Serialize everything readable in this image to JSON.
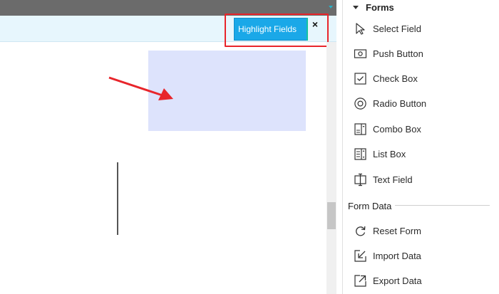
{
  "toolbar": {
    "highlight_label": "Highlight Fields",
    "close_glyph": "×"
  },
  "panel": {
    "forms_title": "Forms",
    "form_tools": [
      {
        "label": "Select Field",
        "icon": "pointer-icon"
      },
      {
        "label": "Push Button",
        "icon": "push-button-icon"
      },
      {
        "label": "Check Box",
        "icon": "check-box-icon"
      },
      {
        "label": "Radio Button",
        "icon": "radio-button-icon"
      },
      {
        "label": "Combo Box",
        "icon": "combo-box-icon"
      },
      {
        "label": "List Box",
        "icon": "list-box-icon"
      },
      {
        "label": "Text Field",
        "icon": "text-field-icon"
      }
    ],
    "form_data_title": "Form Data",
    "data_tools": [
      {
        "label": "Reset Form",
        "icon": "reset-icon"
      },
      {
        "label": "Import Data",
        "icon": "import-icon"
      },
      {
        "label": "Export Data",
        "icon": "export-icon"
      }
    ]
  },
  "colors": {
    "highlight_button": "#1aa8e8",
    "form_bar": "#e7f6fd",
    "field_fill": "#dde3fc",
    "annotation_red": "#e8252b"
  }
}
